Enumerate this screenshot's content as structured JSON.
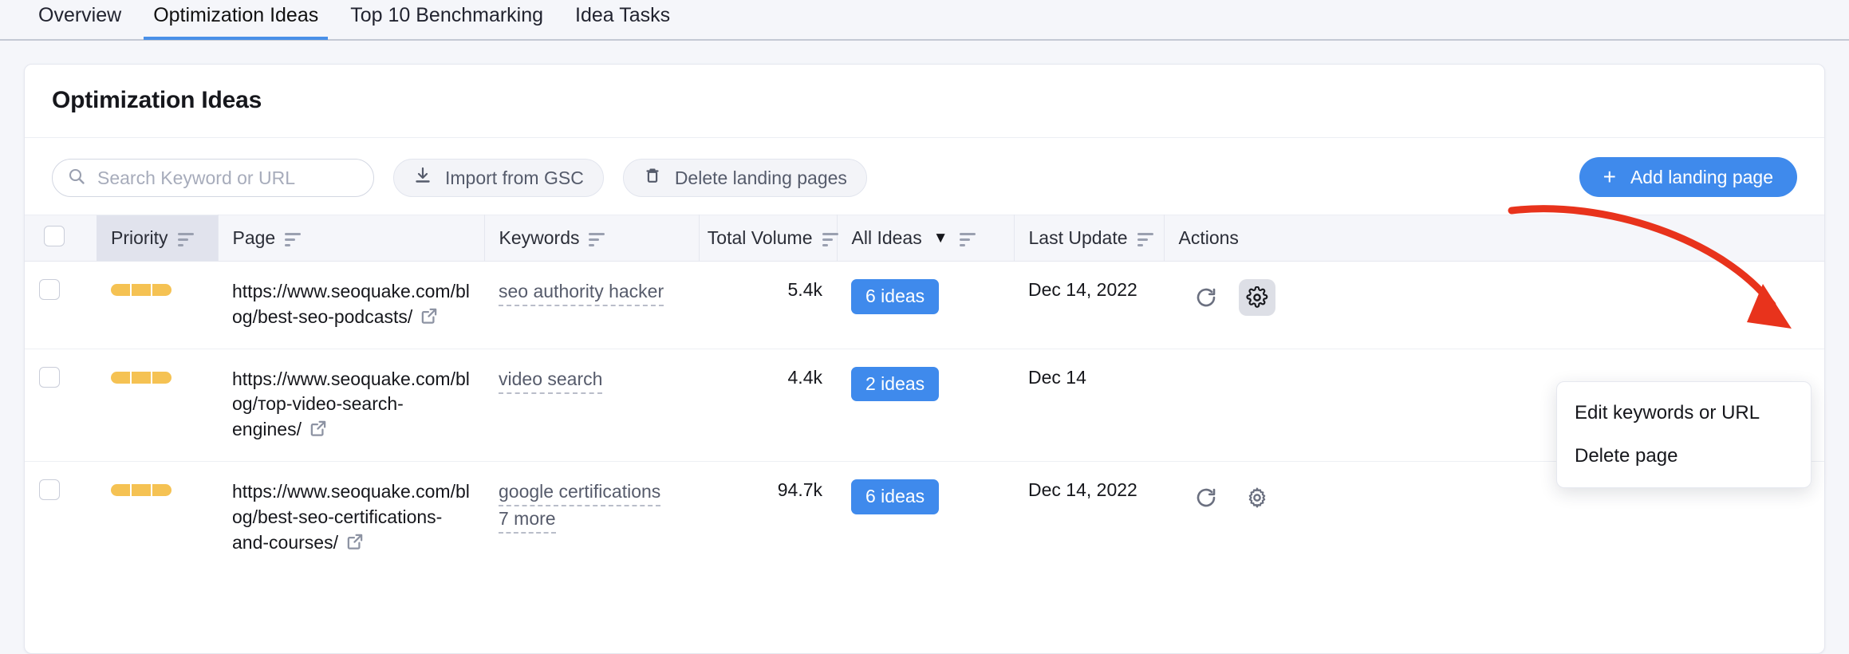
{
  "tabs": [
    {
      "label": "Overview",
      "active": false
    },
    {
      "label": "Optimization Ideas",
      "active": true
    },
    {
      "label": "Top 10 Benchmarking",
      "active": false
    },
    {
      "label": "Idea Tasks",
      "active": false
    }
  ],
  "card": {
    "title": "Optimization Ideas"
  },
  "toolbar": {
    "search_placeholder": "Search Keyword or URL",
    "search_value": "",
    "import_label": "Import from GSC",
    "delete_pages_label": "Delete landing pages",
    "add_page_label": "Add landing page",
    "add_page_plus": "+"
  },
  "table": {
    "columns": [
      {
        "label": "Priority",
        "sortable": true
      },
      {
        "label": "Page",
        "sortable": true
      },
      {
        "label": "Keywords",
        "sortable": true
      },
      {
        "label": "Total Volume",
        "sortable": true
      },
      {
        "label": "All Ideas",
        "sortable": true,
        "dropdown": true
      },
      {
        "label": "Last Update",
        "sortable": true
      },
      {
        "label": "Actions",
        "sortable": false
      }
    ],
    "rows": [
      {
        "priority_segments": 3,
        "url": "https://www.seoquake.com/blog/best-seo-podcasts/",
        "keywords": [
          "seo authority hacker"
        ],
        "total_volume": "5.4k",
        "ideas_badge": "6 ideas",
        "last_update": "Dec 14, 2022"
      },
      {
        "priority_segments": 3,
        "url": "https://www.seoquake.com/blog/тор-video-search-engines/",
        "keywords": [
          "video search"
        ],
        "total_volume": "4.4k",
        "ideas_badge": "2 ideas",
        "last_update": "Dec 14"
      },
      {
        "priority_segments": 3,
        "url": "https://www.seoquake.com/blog/best-seo-certifications-and-courses/",
        "keywords": [
          "google certifications",
          "7 more"
        ],
        "total_volume": "94.7k",
        "ideas_badge": "6 ideas",
        "last_update": "Dec 14, 2022"
      }
    ]
  },
  "context_menu": {
    "items": [
      "Edit keywords or URL",
      "Delete page"
    ]
  },
  "colors": {
    "accent_blue": "#3f8aec",
    "priority_amber": "#f5c253",
    "annotation_red": "#e8331c",
    "header_bg": "#f5f6fa",
    "priority_col_bg": "#e1e3ed"
  }
}
